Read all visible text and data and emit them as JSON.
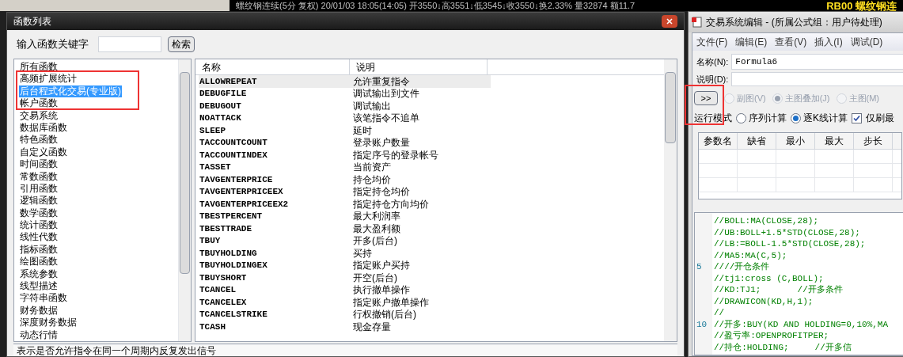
{
  "background": {
    "quote": "螺纹钢连续(5分 复权) 20/01/03 18:05(14:05) 开3550↓高3551↓低3545↓收3550↓换2.33% 量32874 额11.7",
    "symbol": "RB00 螺纹钢连"
  },
  "function_dialog": {
    "title": "函数列表",
    "search_label": "输入函数关键字",
    "search_button": "检索",
    "categories": [
      {
        "label": "所有函数",
        "selected": false
      },
      {
        "label": "高频扩展统计",
        "selected": false
      },
      {
        "label": "后台程式化交易(专业版)",
        "selected": true
      },
      {
        "label": "帐户函数",
        "selected": false
      },
      {
        "label": "交易系统",
        "selected": false
      },
      {
        "label": "数据库函数",
        "selected": false
      },
      {
        "label": "特色函数",
        "selected": false
      },
      {
        "label": "自定义函数",
        "selected": false
      },
      {
        "label": "时间函数",
        "selected": false
      },
      {
        "label": "常数函数",
        "selected": false
      },
      {
        "label": "引用函数",
        "selected": false
      },
      {
        "label": "逻辑函数",
        "selected": false
      },
      {
        "label": "数学函数",
        "selected": false
      },
      {
        "label": "统计函数",
        "selected": false
      },
      {
        "label": "线性代数",
        "selected": false
      },
      {
        "label": "指标函数",
        "selected": false
      },
      {
        "label": "绘图函数",
        "selected": false
      },
      {
        "label": "系统参数",
        "selected": false
      },
      {
        "label": "线型描述",
        "selected": false
      },
      {
        "label": "字符串函数",
        "selected": false
      },
      {
        "label": "财务数据",
        "selected": false
      },
      {
        "label": "深度财务数据",
        "selected": false
      },
      {
        "label": "动态行情",
        "selected": false
      }
    ],
    "columns": [
      "名称",
      "说明"
    ],
    "rows": [
      {
        "name": "ALLOWREPEAT",
        "desc": "允许重复指令",
        "selected": true
      },
      {
        "name": "DEBUGFILE",
        "desc": "调试输出到文件",
        "selected": false
      },
      {
        "name": "DEBUGOUT",
        "desc": "调试输出",
        "selected": false
      },
      {
        "name": "NOATTACK",
        "desc": "该笔指令不追单",
        "selected": false
      },
      {
        "name": "SLEEP",
        "desc": "延时",
        "selected": false
      },
      {
        "name": "TACCOUNTCOUNT",
        "desc": "登录账户数量",
        "selected": false
      },
      {
        "name": "TACCOUNTINDEX",
        "desc": "指定序号的登录帐号",
        "selected": false
      },
      {
        "name": "TASSET",
        "desc": "当前资产",
        "selected": false
      },
      {
        "name": "TAVGENTERPRICE",
        "desc": "持仓均价",
        "selected": false
      },
      {
        "name": "TAVGENTERPRICEEX",
        "desc": "指定持仓均价",
        "selected": false
      },
      {
        "name": "TAVGENTERPRICEEX2",
        "desc": "指定持仓方向均价",
        "selected": false
      },
      {
        "name": "TBESTPERCENT",
        "desc": "最大利润率",
        "selected": false
      },
      {
        "name": "TBESTTRADE",
        "desc": "最大盈利额",
        "selected": false
      },
      {
        "name": "TBUY",
        "desc": "开多(后台)",
        "selected": false
      },
      {
        "name": "TBUYHOLDING",
        "desc": "买持",
        "selected": false
      },
      {
        "name": "TBUYHOLDINGEX",
        "desc": "指定账户买持",
        "selected": false
      },
      {
        "name": "TBUYSHORT",
        "desc": "开空(后台)",
        "selected": false
      },
      {
        "name": "TCANCEL",
        "desc": "执行撤单操作",
        "selected": false
      },
      {
        "name": "TCANCELEX",
        "desc": "指定账户撤单操作",
        "selected": false
      },
      {
        "name": "TCANCELSTRIKE",
        "desc": "行权撤销(后台)",
        "selected": false
      },
      {
        "name": "TCASH",
        "desc": "现金存量",
        "selected": false
      }
    ],
    "status_text": "表示是否允许指令在同一个周期内反复发出信号"
  },
  "editor": {
    "title": "交易系统编辑 - (所属公式组：用户待处理)",
    "menu": [
      "文件(F)",
      "编辑(E)",
      "查看(V)",
      "插入(I)",
      "调试(D)"
    ],
    "name_label": "名称(N):",
    "name_value": "Formula6",
    "desc_label": "说明(D):",
    "expand_button": ">>",
    "chart_options": [
      {
        "label": "副图(V)",
        "selected": false,
        "disabled": true
      },
      {
        "label": "主图叠加(J)",
        "selected": true,
        "disabled": true
      },
      {
        "label": "主图(M)",
        "selected": false,
        "disabled": true
      }
    ],
    "run_mode_label": "运行模式",
    "run_modes": [
      {
        "label": "序列计算",
        "selected": false
      },
      {
        "label": "逐K线计算",
        "selected": true
      }
    ],
    "refresh_only": {
      "label": "仅刷最",
      "checked": true
    },
    "param_columns": [
      "参数名",
      "缺省",
      "最小",
      "最大",
      "步长"
    ],
    "code_lines": [
      {
        "text": "//BOLL:MA(CLOSE,28);"
      },
      {
        "text": "//UB:BOLL+1.5*STD(CLOSE,28);"
      },
      {
        "text": "//LB:=BOLL-1.5*STD(CLOSE,28);"
      },
      {
        "text": "//MA5:MA(C,5);"
      },
      {
        "number": "5",
        "text": "////开仓条件"
      },
      {
        "text": "//tj1:cross (C,BOLL);"
      },
      {
        "text": "//KD:TJ1;       //开多条件"
      },
      {
        "text": "//DRAWICON(KD,H,1);"
      },
      {
        "text": "//"
      },
      {
        "number": "10",
        "text": "//开多:BUY(KD AND HOLDING=0,10%,MA"
      },
      {
        "text": "//盈亏率:OPENPROFITPER;"
      },
      {
        "text": "//持仓:HOLDING;     //开多信"
      }
    ]
  }
}
